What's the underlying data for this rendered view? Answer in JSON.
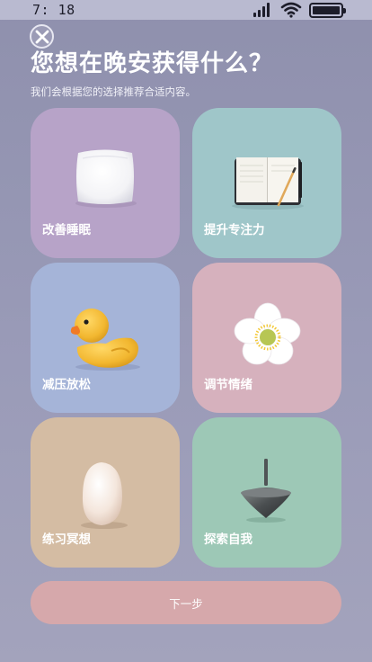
{
  "status": {
    "time": "7: 18"
  },
  "header": {
    "title": "您想在晚安获得什么？",
    "subtitle": "我们会根据您的选择推荐合适内容。"
  },
  "options": [
    {
      "label": "改善睡眠",
      "color": "#b7a3c8",
      "icon": "pillow-icon"
    },
    {
      "label": "提升专注力",
      "color": "#9fc6c9",
      "icon": "notebook-icon"
    },
    {
      "label": "减压放松",
      "color": "#a5b4d8",
      "icon": "rubber-duck-icon"
    },
    {
      "label": "调节情绪",
      "color": "#d6b1bd",
      "icon": "flower-icon"
    },
    {
      "label": "练习冥想",
      "color": "#d4bca3",
      "icon": "egg-icon"
    },
    {
      "label": "探索自我",
      "color": "#9dc8b6",
      "icon": "spinning-top-icon"
    }
  ],
  "footer": {
    "next_label": "下一步",
    "next_color": "#d6a8ab"
  }
}
